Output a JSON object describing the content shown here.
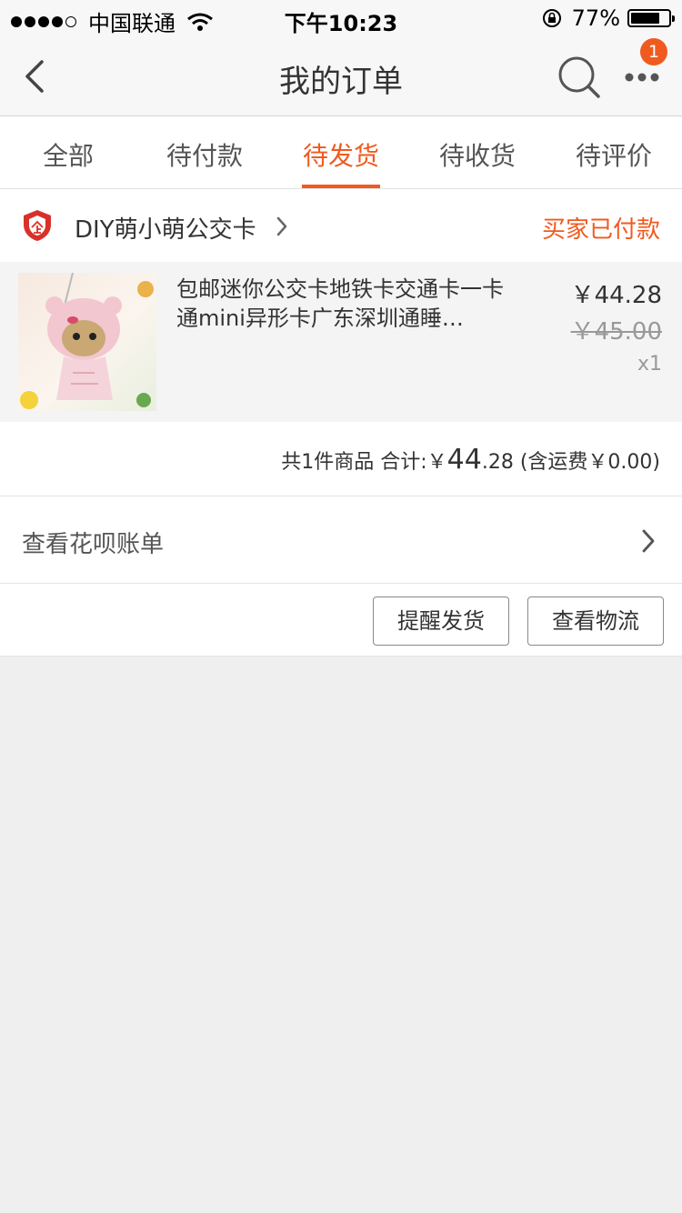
{
  "status_bar": {
    "carrier": "中国联通",
    "time": "下午10:23",
    "battery_percent": "77%",
    "battery_level": 0.77
  },
  "nav": {
    "title": "我的订单",
    "badge_count": "1",
    "back_icon": "chevron-left-icon",
    "search_icon": "search-icon",
    "more_icon": "more-icon"
  },
  "tabs": [
    {
      "label": "全部"
    },
    {
      "label": "待付款"
    },
    {
      "label": "待发货",
      "active": true
    },
    {
      "label": "待收货"
    },
    {
      "label": "待评价"
    }
  ],
  "order": {
    "shop_name": "DIY萌小萌公交卡",
    "status": "买家已付款",
    "item": {
      "title": "包邮迷你公交卡地铁卡交通卡一卡通mini异形卡广东深圳通睡…",
      "price": "￥44.28",
      "original_price": "￥45.00",
      "quantity": "x1"
    },
    "summary": {
      "count_text": "共1件商品  合计:",
      "currency": "￥",
      "total_int": "44",
      "total_dec": ".28",
      "shipping_text": " (含运费￥0.00)"
    }
  },
  "bill_row": {
    "label": "查看花呗账单"
  },
  "buttons": {
    "remind": "提醒发货",
    "logistics": "查看物流"
  },
  "colors": {
    "accent": "#f05a1f",
    "background": "#efefef",
    "shop_icon_red": "#d9312a"
  }
}
